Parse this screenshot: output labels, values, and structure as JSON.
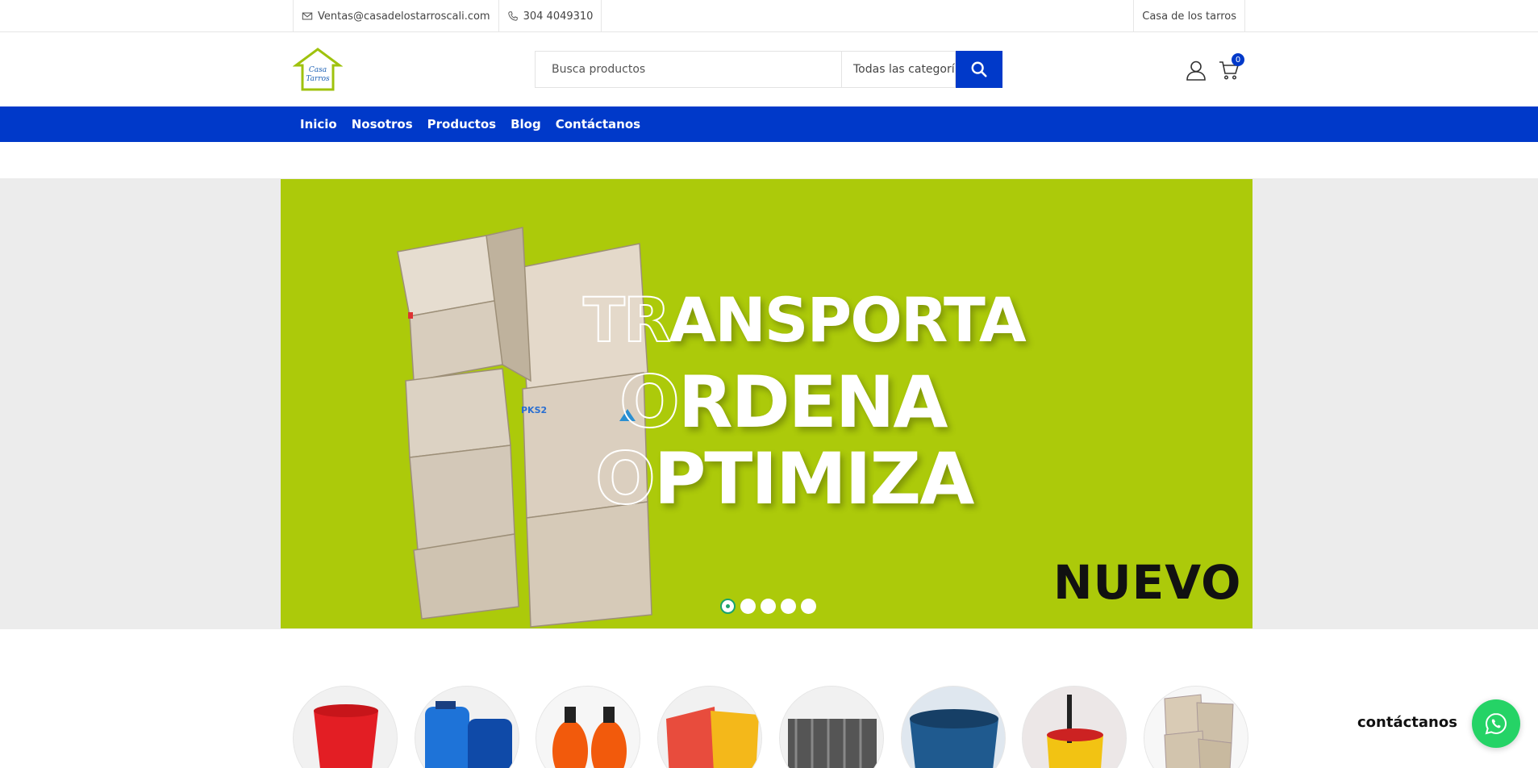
{
  "topbar": {
    "email": "Ventas@casadelostarroscali.com",
    "phone": "304 4049310",
    "store_name": "Casa de los tarros"
  },
  "header": {
    "logo_text_top": "Casa",
    "logo_text_bottom": "Tarros",
    "search_placeholder": "Busca productos",
    "category_select": "Todas las categorías",
    "cart_count": "0"
  },
  "nav": {
    "items": [
      "Inicio",
      "Nosotros",
      "Productos",
      "Blog",
      "Contáctanos"
    ]
  },
  "slider": {
    "line1": "TRANSPORTA",
    "line1_outline": "TR",
    "line1_rest": "ANSPORTA",
    "line2_outline": "O",
    "line2_rest": "RDENA",
    "line3_outline": "O",
    "line3_rest": "PTIMIZA",
    "badge": "NUEVO",
    "box_label": "PKS2",
    "slides_total": 5,
    "active_slide": 1
  },
  "whatsapp": {
    "label": "contáctanos"
  },
  "colors": {
    "brand_blue": "#0039c9",
    "slide_green": "#acca0a",
    "whatsapp_green": "#25d366"
  }
}
